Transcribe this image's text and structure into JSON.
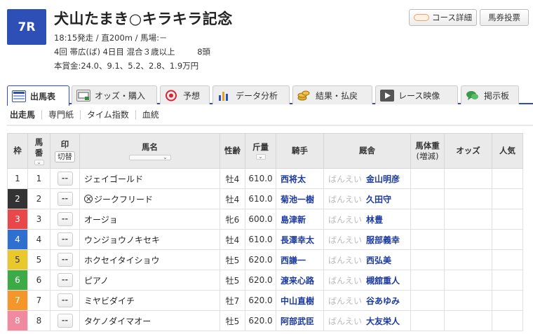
{
  "race": {
    "number": "7R",
    "name": "犬山たまき○キラキラ記念",
    "data01": "18:15発走 / 直200m / 馬場:－",
    "data02_a": "4回  帯広(ば)  4日目  混合３歳以上",
    "data02_b": "8頭",
    "data03": "本賞金:24.0、9.1、5.2、2.8、1.9万円"
  },
  "header_buttons": {
    "course": "コース詳細",
    "bet": "馬券投票"
  },
  "tabs": [
    {
      "label": "出馬表",
      "icon": "table-icon"
    },
    {
      "label": "オッズ・購入",
      "icon": "odds-icon"
    },
    {
      "label": "予想",
      "icon": "target-icon"
    },
    {
      "label": "データ分析",
      "icon": "bar-chart-icon"
    },
    {
      "label": "結果・払戻",
      "icon": "coins-icon"
    },
    {
      "label": "レース映像",
      "icon": "video-icon"
    },
    {
      "label": "掲示板",
      "icon": "chat-icon"
    }
  ],
  "subtabs": [
    "出走馬",
    "専門紙",
    "タイム指数",
    "血統"
  ],
  "table": {
    "headers": {
      "waku": "枠",
      "umaban_1": "馬",
      "umaban_2": "番",
      "mark": "印",
      "kiri": "切替",
      "horse": "馬名",
      "sexage": "性齢",
      "kinryo": "斤量",
      "jockey": "騎手",
      "trainer": "厩舎",
      "weight_1": "馬体重",
      "weight_2": "(増減)",
      "odds": "オッズ",
      "popular": "人気"
    },
    "rows": [
      {
        "waku": "1",
        "umaban": "1",
        "mark": "--",
        "horse": "ジェイゴールド",
        "sexage": "牡4",
        "kinryo": "610.0",
        "jockey": "西将太",
        "stable": "ばんえい",
        "trainer": "金山明彦"
      },
      {
        "waku": "2",
        "umaban": "2",
        "mark": "--",
        "horse": "ジークフリード",
        "sexage": "牡4",
        "kinryo": "610.0",
        "jockey": "菊池一樹",
        "stable": "ばんえい",
        "trainer": "久田守"
      },
      {
        "waku": "3",
        "umaban": "3",
        "mark": "--",
        "horse": "オージョ",
        "sexage": "牝6",
        "kinryo": "600.0",
        "jockey": "島津新",
        "stable": "ばんえい",
        "trainer": "林豊"
      },
      {
        "waku": "4",
        "umaban": "4",
        "mark": "--",
        "horse": "ウンジョウノキセキ",
        "sexage": "牡4",
        "kinryo": "610.0",
        "jockey": "長澤幸太",
        "stable": "ばんえい",
        "trainer": "服部義幸"
      },
      {
        "waku": "5",
        "umaban": "5",
        "mark": "--",
        "horse": "ホクセイタイショウ",
        "sexage": "牡5",
        "kinryo": "620.0",
        "jockey": "西謙一",
        "stable": "ばんえい",
        "trainer": "西弘美"
      },
      {
        "waku": "6",
        "umaban": "6",
        "mark": "--",
        "horse": "ピアノ",
        "sexage": "牡5",
        "kinryo": "620.0",
        "jockey": "渡来心路",
        "stable": "ばんえい",
        "trainer": "槻舘重人"
      },
      {
        "waku": "7",
        "umaban": "7",
        "mark": "--",
        "horse": "ミヤビダイチ",
        "sexage": "牡7",
        "kinryo": "620.0",
        "jockey": "中山直樹",
        "stable": "ばんえい",
        "trainer": "谷あゆみ"
      },
      {
        "waku": "8",
        "umaban": "8",
        "mark": "--",
        "horse": "タケノダイマオー",
        "sexage": "牡5",
        "kinryo": "620.0",
        "jockey": "阿部武臣",
        "stable": "ばんえい",
        "trainer": "大友栄人"
      }
    ]
  }
}
